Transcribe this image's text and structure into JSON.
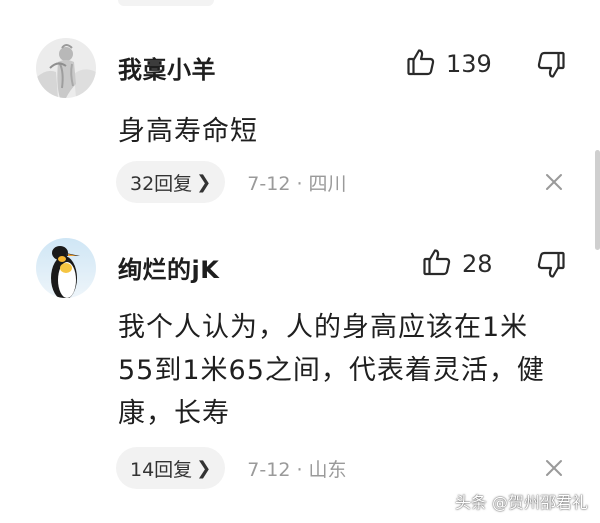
{
  "comments": [
    {
      "username": "我稾小羊",
      "likes": "139",
      "text": "身高寿命短",
      "replies_label": "32回复",
      "reply_chevron": "❯",
      "date_location": "7-12 · 四川",
      "avatar_icon": "statue-avatar-icon"
    },
    {
      "username": "绚烂的jK",
      "likes": "28",
      "text": "我个人认为，人的身高应该在1米55到1米65之间，代表着灵活，健康，长寿",
      "replies_label": "14回复",
      "reply_chevron": "❯",
      "date_location": "7-12 · 山东",
      "avatar_icon": "penguin-avatar-icon"
    }
  ],
  "watermark": "头条 @贺州邵君礼",
  "colors": {
    "meta_gray": "#9a9a9a",
    "pill_bg": "#f2f2f2",
    "text_dark": "#1f1f1f"
  }
}
